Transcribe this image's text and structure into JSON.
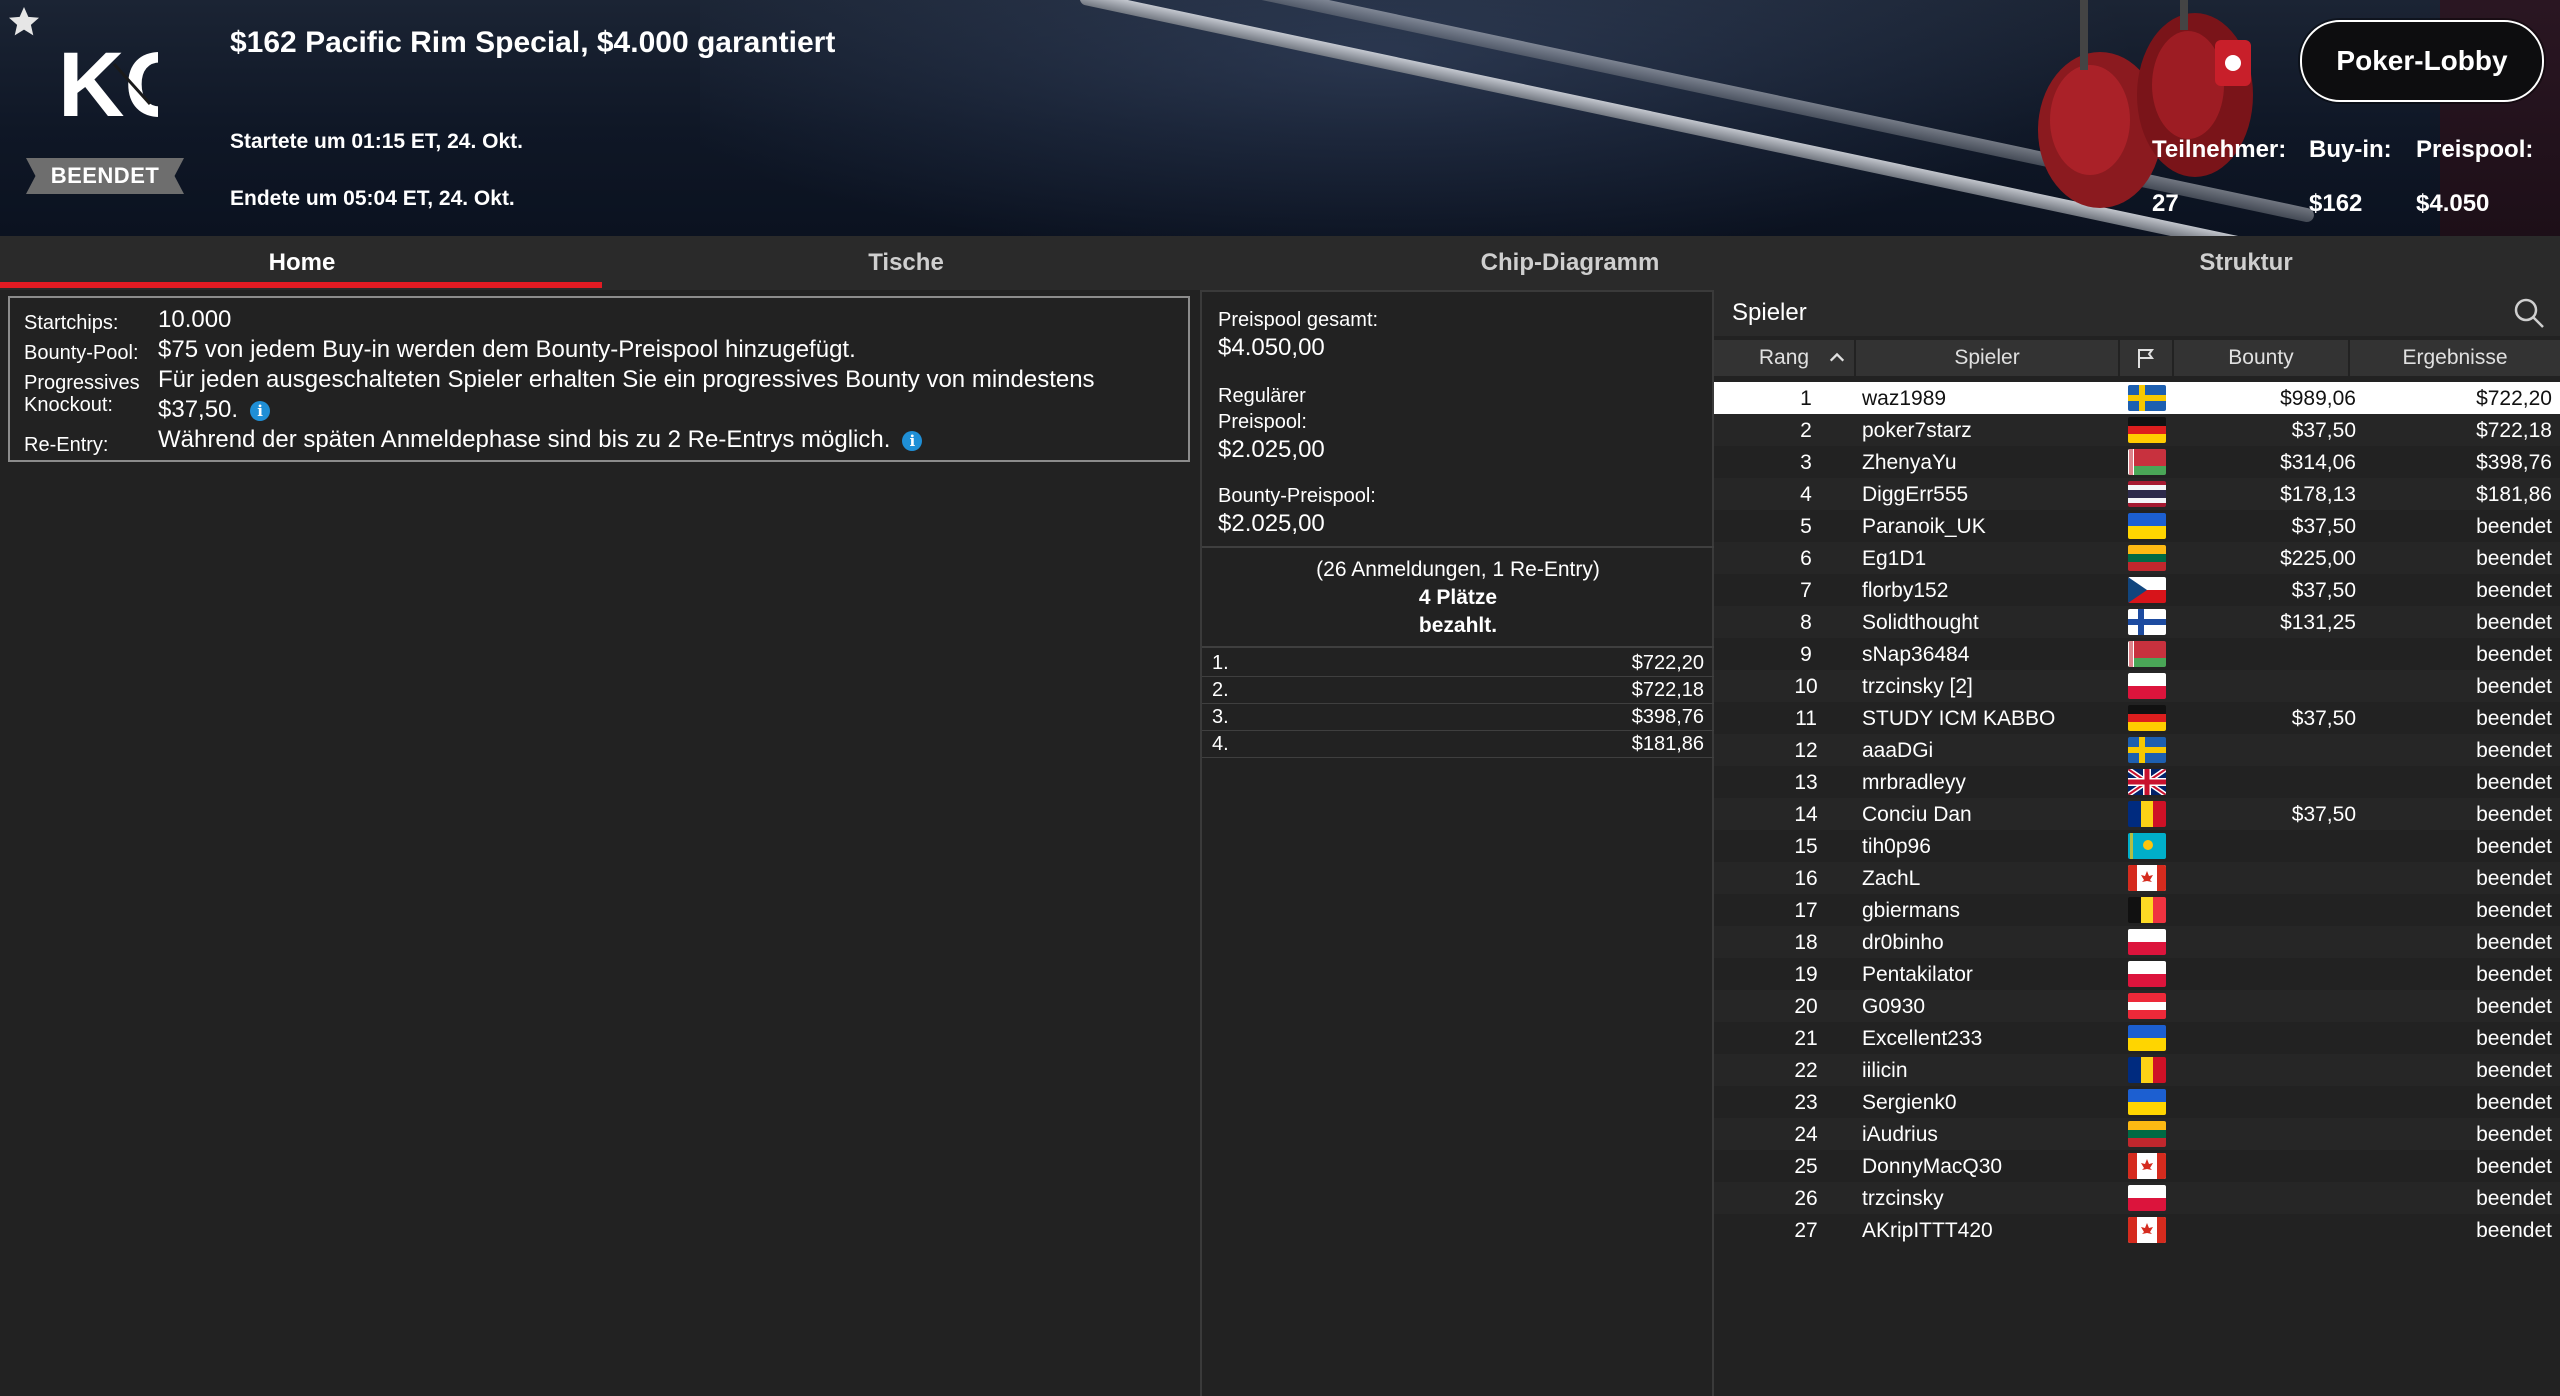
{
  "header": {
    "title": "$162 Pacific Rim Special, $4.000 garantiert",
    "started": "Startete um 01:15 ET, 24. Okt.",
    "ended": "Endete um 05:04 ET, 24. Okt.",
    "status": "BEENDET",
    "logo_text": "KO",
    "lobby_button": "Poker-Lobby",
    "stats": {
      "participants_label": "Teilnehmer:",
      "participants_value": "27",
      "buyin_label": "Buy-in:",
      "buyin_value": "$162",
      "prizepool_label": "Preispool:",
      "prizepool_value": "$4.050"
    }
  },
  "tabs": [
    {
      "label": "Home",
      "active": true
    },
    {
      "label": "Tische",
      "active": false
    },
    {
      "label": "Chip-Diagramm",
      "active": false
    },
    {
      "label": "Struktur",
      "active": false
    }
  ],
  "info": {
    "startchips_label": "Startchips:",
    "startchips_value": "10.000",
    "bountypool_label": "Bounty-Pool:",
    "bountypool_value": "$75 von jedem Buy-in werden dem Bounty-Preispool hinzugefügt.",
    "progressive_label_1": "Progressives",
    "progressive_label_2": "Knockout:",
    "progressive_value_1": "Für jeden ausgeschalteten Spieler erhalten Sie ein progressives Bounty von mindestens",
    "progressive_value_2": "$37,50.",
    "reentry_label": "Re-Entry:",
    "reentry_value": "Während der späten Anmeldephase sind bis zu 2 Re-Entrys möglich.",
    "info_icon_glyph": "i"
  },
  "prizepool": {
    "total_label": "Preispool gesamt:",
    "total_value": "$4.050,00",
    "regular_label_1": "Regulärer",
    "regular_label_2": "Preispool:",
    "regular_value": "$2.025,00",
    "bounty_label": "Bounty-Preispool:",
    "bounty_value": "$2.025,00",
    "registrations": "(26 Anmeldungen, 1 Re-Entry)",
    "places_1": "4 Plätze",
    "places_2": "bezahlt.",
    "payouts": [
      {
        "place": "1.",
        "amount": "$722,20"
      },
      {
        "place": "2.",
        "amount": "$722,18"
      },
      {
        "place": "3.",
        "amount": "$398,76"
      },
      {
        "place": "4.",
        "amount": "$181,86"
      }
    ]
  },
  "players_panel": {
    "search_label": "Spieler",
    "columns": {
      "rank": "Rang",
      "player": "Spieler",
      "bounty": "Bounty",
      "result": "Ergebnisse"
    },
    "rows": [
      {
        "rank": "1",
        "name": "waz1989",
        "flag": "SE",
        "bounty": "$989,06",
        "result": "$722,20"
      },
      {
        "rank": "2",
        "name": "poker7starz",
        "flag": "DE",
        "bounty": "$37,50",
        "result": "$722,18"
      },
      {
        "rank": "3",
        "name": "ZhenyaYu",
        "flag": "BY",
        "bounty": "$314,06",
        "result": "$398,76"
      },
      {
        "rank": "4",
        "name": "DiggErr555",
        "flag": "TH",
        "bounty": "$178,13",
        "result": "$181,86"
      },
      {
        "rank": "5",
        "name": "Paranoik_UK",
        "flag": "UA",
        "bounty": "$37,50",
        "result": "beendet"
      },
      {
        "rank": "6",
        "name": "Eg1D1",
        "flag": "LT",
        "bounty": "$225,00",
        "result": "beendet"
      },
      {
        "rank": "7",
        "name": "florby152",
        "flag": "CZ",
        "bounty": "$37,50",
        "result": "beendet"
      },
      {
        "rank": "8",
        "name": "Solidthought",
        "flag": "FI",
        "bounty": "$131,25",
        "result": "beendet"
      },
      {
        "rank": "9",
        "name": "sNap36484",
        "flag": "BY",
        "bounty": "",
        "result": "beendet"
      },
      {
        "rank": "10",
        "name": "trzcinsky [2]",
        "flag": "PL",
        "bounty": "",
        "result": "beendet"
      },
      {
        "rank": "11",
        "name": "STUDY ICM KABBO",
        "flag": "DE",
        "bounty": "$37,50",
        "result": "beendet"
      },
      {
        "rank": "12",
        "name": "aaaDGi",
        "flag": "SE",
        "bounty": "",
        "result": "beendet"
      },
      {
        "rank": "13",
        "name": "mrbradleyy",
        "flag": "GB",
        "bounty": "",
        "result": "beendet"
      },
      {
        "rank": "14",
        "name": "Conciu Dan",
        "flag": "RO",
        "bounty": "$37,50",
        "result": "beendet"
      },
      {
        "rank": "15",
        "name": "tih0p96",
        "flag": "KZ",
        "bounty": "",
        "result": "beendet"
      },
      {
        "rank": "16",
        "name": "ZachL",
        "flag": "CA",
        "bounty": "",
        "result": "beendet"
      },
      {
        "rank": "17",
        "name": "gbiermans",
        "flag": "BE",
        "bounty": "",
        "result": "beendet"
      },
      {
        "rank": "18",
        "name": "dr0binho",
        "flag": "PL",
        "bounty": "",
        "result": "beendet"
      },
      {
        "rank": "19",
        "name": "Pentakilator",
        "flag": "PL",
        "bounty": "",
        "result": "beendet"
      },
      {
        "rank": "20",
        "name": "G0930",
        "flag": "AT",
        "bounty": "",
        "result": "beendet"
      },
      {
        "rank": "21",
        "name": "Excellent233",
        "flag": "UA",
        "bounty": "",
        "result": "beendet"
      },
      {
        "rank": "22",
        "name": "iilicin",
        "flag": "RO",
        "bounty": "",
        "result": "beendet"
      },
      {
        "rank": "23",
        "name": "Sergienk0",
        "flag": "UA",
        "bounty": "",
        "result": "beendet"
      },
      {
        "rank": "24",
        "name": "iAudrius",
        "flag": "LT",
        "bounty": "",
        "result": "beendet"
      },
      {
        "rank": "25",
        "name": "DonnyMacQ30",
        "flag": "CA",
        "bounty": "",
        "result": "beendet"
      },
      {
        "rank": "26",
        "name": "trzcinsky",
        "flag": "PL",
        "bounty": "",
        "result": "beendet"
      },
      {
        "rank": "27",
        "name": "AKripITTT420",
        "flag": "CA",
        "bounty": "",
        "result": "beendet"
      }
    ]
  },
  "colors": {
    "accent": "#e31b23",
    "info_icon": "#1f8fd6",
    "selected_row": "#ffffff"
  },
  "icons": [
    "star-icon",
    "search-icon",
    "flag-icon",
    "sort-up-icon",
    "info-icon",
    "boxing-gloves-icon"
  ]
}
